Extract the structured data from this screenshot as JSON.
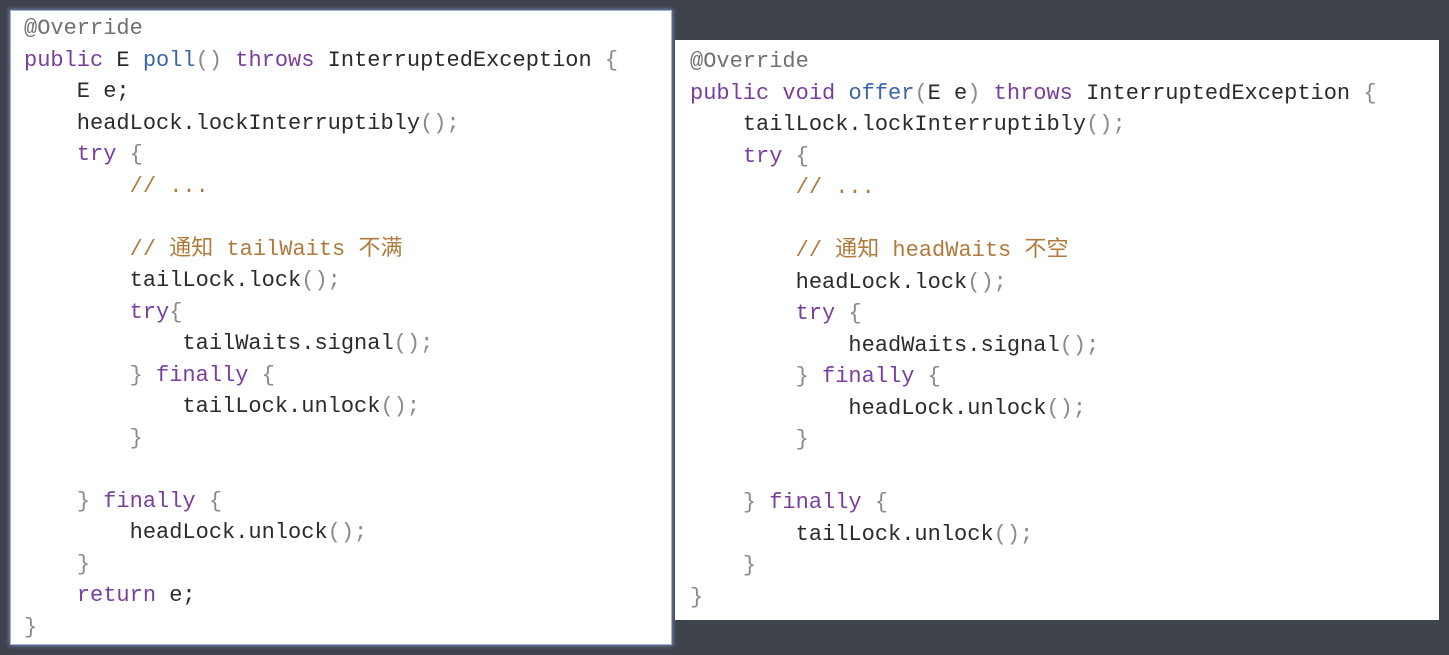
{
  "colors": {
    "background": "#3f434c",
    "panel": "#ffffff",
    "keyword": "#7a3e9d",
    "function": "#3a66a8",
    "comment": "#b07a3c",
    "annotation": "#707070",
    "punctuation": "#8a8a8a",
    "text": "#2b2b2b"
  },
  "left_panel": {
    "lines": [
      [
        [
          "an",
          "@Override"
        ]
      ],
      [
        [
          "kw",
          "public"
        ],
        [
          "tx",
          " E "
        ],
        [
          "fn",
          "poll"
        ],
        [
          "pn",
          "()"
        ],
        [
          "tx",
          " "
        ],
        [
          "kw",
          "throws"
        ],
        [
          "tx",
          " InterruptedException "
        ],
        [
          "pn",
          "{"
        ]
      ],
      [
        [
          "tx",
          "    E e;"
        ]
      ],
      [
        [
          "tx",
          "    headLock.lockInterruptibly"
        ],
        [
          "pn",
          "();"
        ]
      ],
      [
        [
          "tx",
          "    "
        ],
        [
          "kw",
          "try"
        ],
        [
          "tx",
          " "
        ],
        [
          "pn",
          "{"
        ]
      ],
      [
        [
          "tx",
          "        "
        ],
        [
          "cm",
          "// ..."
        ]
      ],
      [],
      [
        [
          "tx",
          "        "
        ],
        [
          "cm",
          "// 通知 tailWaits 不满"
        ]
      ],
      [
        [
          "tx",
          "        tailLock.lock"
        ],
        [
          "pn",
          "();"
        ]
      ],
      [
        [
          "tx",
          "        "
        ],
        [
          "kw",
          "try"
        ],
        [
          "pn",
          "{"
        ]
      ],
      [
        [
          "tx",
          "            tailWaits.signal"
        ],
        [
          "pn",
          "();"
        ]
      ],
      [
        [
          "tx",
          "        "
        ],
        [
          "pn",
          "}"
        ],
        [
          "tx",
          " "
        ],
        [
          "kw",
          "finally"
        ],
        [
          "tx",
          " "
        ],
        [
          "pn",
          "{"
        ]
      ],
      [
        [
          "tx",
          "            tailLock.unlock"
        ],
        [
          "pn",
          "();"
        ]
      ],
      [
        [
          "tx",
          "        "
        ],
        [
          "pn",
          "}"
        ]
      ],
      [],
      [
        [
          "tx",
          "    "
        ],
        [
          "pn",
          "}"
        ],
        [
          "tx",
          " "
        ],
        [
          "kw",
          "finally"
        ],
        [
          "tx",
          " "
        ],
        [
          "pn",
          "{"
        ]
      ],
      [
        [
          "tx",
          "        headLock.unlock"
        ],
        [
          "pn",
          "();"
        ]
      ],
      [
        [
          "tx",
          "    "
        ],
        [
          "pn",
          "}"
        ]
      ],
      [
        [
          "tx",
          "    "
        ],
        [
          "kw",
          "return"
        ],
        [
          "tx",
          " e;"
        ]
      ],
      [
        [
          "pn",
          "}"
        ]
      ]
    ]
  },
  "right_panel": {
    "lines": [
      [
        [
          "an",
          "@Override"
        ]
      ],
      [
        [
          "kw",
          "public"
        ],
        [
          "tx",
          " "
        ],
        [
          "kw",
          "void"
        ],
        [
          "tx",
          " "
        ],
        [
          "fn",
          "offer"
        ],
        [
          "pn",
          "("
        ],
        [
          "tx",
          "E e"
        ],
        [
          "pn",
          ")"
        ],
        [
          "tx",
          " "
        ],
        [
          "kw",
          "throws"
        ],
        [
          "tx",
          " InterruptedException "
        ],
        [
          "pn",
          "{"
        ]
      ],
      [
        [
          "tx",
          "    tailLock.lockInterruptibly"
        ],
        [
          "pn",
          "();"
        ]
      ],
      [
        [
          "tx",
          "    "
        ],
        [
          "kw",
          "try"
        ],
        [
          "tx",
          " "
        ],
        [
          "pn",
          "{"
        ]
      ],
      [
        [
          "tx",
          "        "
        ],
        [
          "cm",
          "// ..."
        ]
      ],
      [],
      [
        [
          "tx",
          "        "
        ],
        [
          "cm",
          "// 通知 headWaits 不空"
        ]
      ],
      [
        [
          "tx",
          "        headLock.lock"
        ],
        [
          "pn",
          "();"
        ]
      ],
      [
        [
          "tx",
          "        "
        ],
        [
          "kw",
          "try"
        ],
        [
          "tx",
          " "
        ],
        [
          "pn",
          "{"
        ]
      ],
      [
        [
          "tx",
          "            headWaits.signal"
        ],
        [
          "pn",
          "();"
        ]
      ],
      [
        [
          "tx",
          "        "
        ],
        [
          "pn",
          "}"
        ],
        [
          "tx",
          " "
        ],
        [
          "kw",
          "finally"
        ],
        [
          "tx",
          " "
        ],
        [
          "pn",
          "{"
        ]
      ],
      [
        [
          "tx",
          "            headLock.unlock"
        ],
        [
          "pn",
          "();"
        ]
      ],
      [
        [
          "tx",
          "        "
        ],
        [
          "pn",
          "}"
        ]
      ],
      [],
      [
        [
          "tx",
          "    "
        ],
        [
          "pn",
          "}"
        ],
        [
          "tx",
          " "
        ],
        [
          "kw",
          "finally"
        ],
        [
          "tx",
          " "
        ],
        [
          "pn",
          "{"
        ]
      ],
      [
        [
          "tx",
          "        tailLock.unlock"
        ],
        [
          "pn",
          "();"
        ]
      ],
      [
        [
          "tx",
          "    "
        ],
        [
          "pn",
          "}"
        ]
      ],
      [
        [
          "pn",
          "}"
        ]
      ]
    ]
  }
}
